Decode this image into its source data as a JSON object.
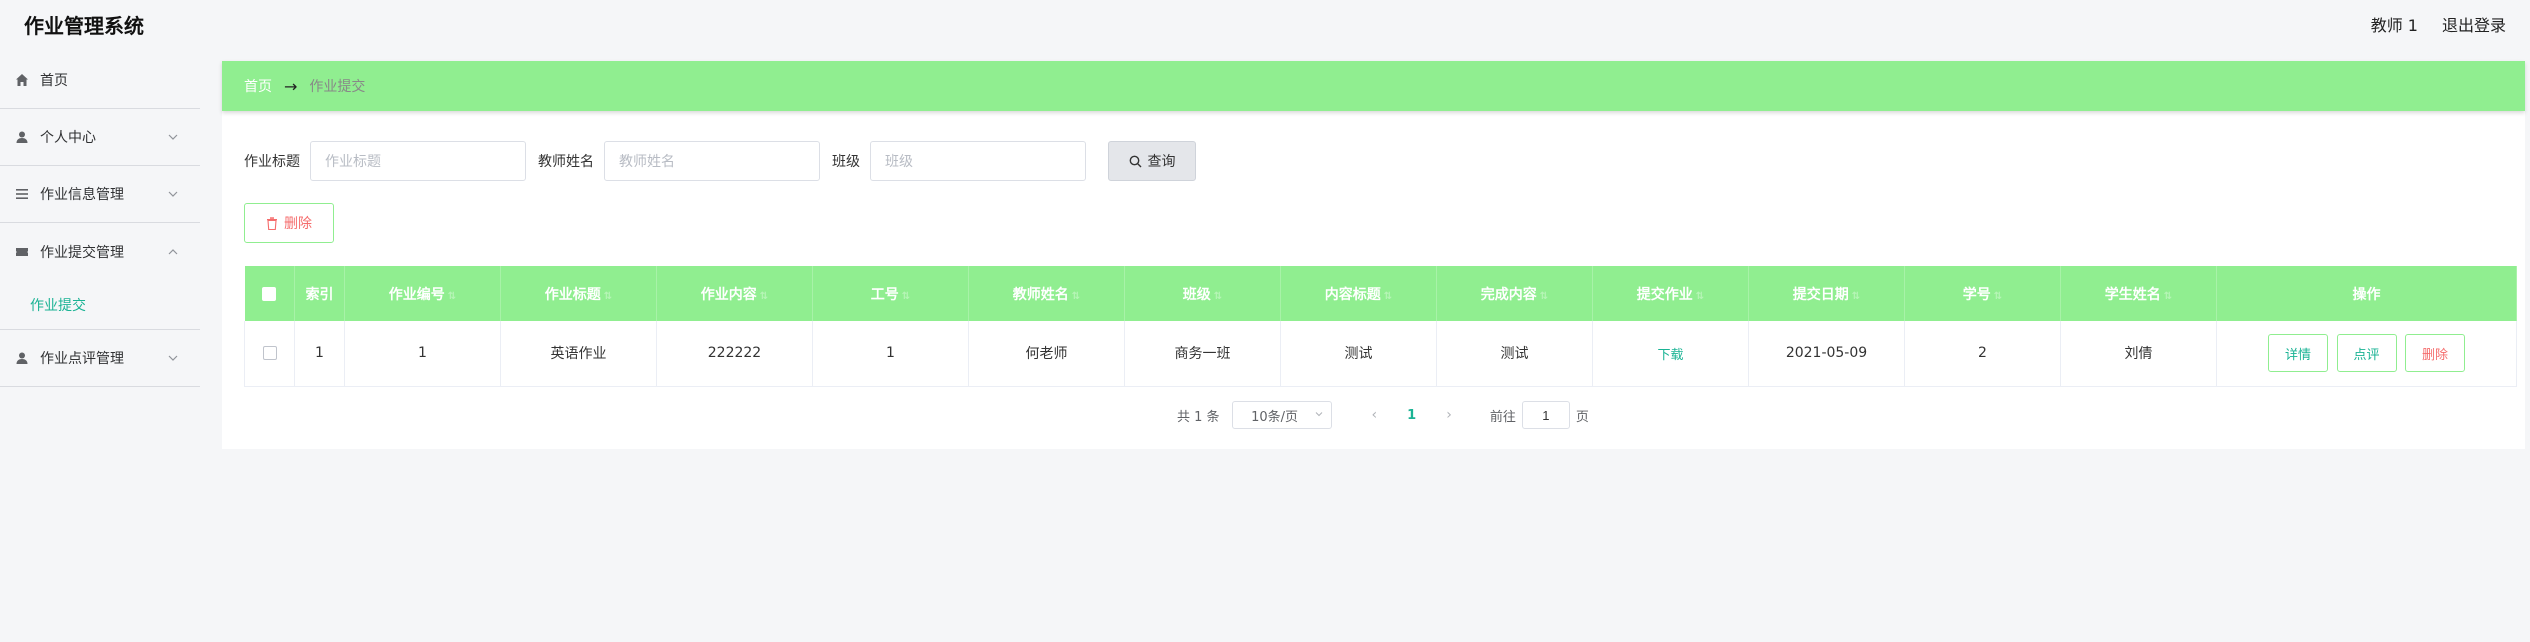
{
  "header": {
    "app_title": "作业管理系统",
    "user_label": "教师 1",
    "logout_label": "退出登录"
  },
  "sidebar": {
    "items": [
      {
        "label": "首页",
        "icon": "home-icon"
      },
      {
        "label": "个人中心",
        "icon": "user-icon"
      },
      {
        "label": "作业信息管理",
        "icon": "list-icon"
      },
      {
        "label": "作业提交管理",
        "icon": "ticket-icon"
      },
      {
        "label": "作业点评管理",
        "icon": "user-icon"
      }
    ],
    "sub_item": "作业提交"
  },
  "breadcrumb": {
    "home": "首页",
    "separator": "→",
    "current": "作业提交"
  },
  "search": {
    "title_label": "作业标题",
    "title_placeholder": "作业标题",
    "teacher_label": "教师姓名",
    "teacher_placeholder": "教师姓名",
    "class_label": "班级",
    "class_placeholder": "班级",
    "query_label": "查询"
  },
  "toolbar": {
    "delete_label": "删除"
  },
  "table": {
    "headers": [
      "索引",
      "作业编号",
      "作业标题",
      "作业内容",
      "工号",
      "教师姓名",
      "班级",
      "内容标题",
      "完成内容",
      "提交作业",
      "提交日期",
      "学号",
      "学生姓名",
      "操作"
    ],
    "rows": [
      {
        "index": "1",
        "hw_no": "1",
        "hw_title": "英语作业",
        "hw_content": "222222",
        "staff_no": "1",
        "teacher": "何老师",
        "class": "商务一班",
        "content_title": "测试",
        "done_content": "测试",
        "submit_link": "下载",
        "date": "2021-05-09",
        "student_no": "2",
        "student_name": "刘倩",
        "actions": {
          "detail": "详情",
          "review": "点评",
          "delete": "删除"
        }
      }
    ]
  },
  "pagination": {
    "total": "共 1 条",
    "page_size": "10条/页",
    "current_page": "1",
    "goto_prefix": "前往",
    "goto_value": "1",
    "goto_suffix": "页"
  },
  "colors": {
    "accent_green": "#90ee90",
    "link_teal": "#1ab394",
    "danger_red": "#f56c6c"
  }
}
